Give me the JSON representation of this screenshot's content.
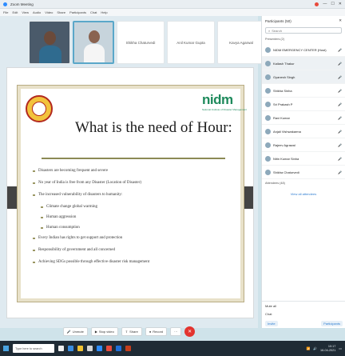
{
  "window": {
    "title": "Zoom Meeting",
    "menu": [
      "File",
      "Edit",
      "View",
      "Audio",
      "Video",
      "Share",
      "Participants",
      "Chat",
      "Help"
    ]
  },
  "colors": {
    "brand": "#1e8a5c",
    "end": "#e3342f",
    "accent": "#2f7dd1"
  },
  "videos": [
    {
      "label": ""
    },
    {
      "label": ""
    },
    {
      "label": "Shikha Chaturvedi"
    },
    {
      "label": "Anil Kumar Gupta"
    },
    {
      "label": "Kavya Agarwal"
    }
  ],
  "slide": {
    "title": "What is the need of Hour:",
    "logo": "nidm",
    "logo_sub": "National Institute of Disaster Management",
    "bullets": [
      {
        "text": "Disasters are becoming frequent and severe",
        "level": 1
      },
      {
        "text": "No year of India is free from any Disaster (Location of Disaster)",
        "level": 1
      },
      {
        "text": "The increased vulnerability of disasters to humanity:",
        "level": 1
      },
      {
        "text": "Climate change global warming",
        "level": 2
      },
      {
        "text": "Human aggression",
        "level": 2
      },
      {
        "text": "Human consumption",
        "level": 2
      },
      {
        "text": "Every Indian has rights to get support and protection",
        "level": 1
      },
      {
        "text": "Responsibility of government and all concerned",
        "level": 1
      },
      {
        "text": "Achieving SDGs possible through effective disaster risk management",
        "level": 1
      }
    ]
  },
  "controls": {
    "mic": "Unmute",
    "video": "Stop video",
    "share": "Share",
    "record": "Record",
    "end": "✕"
  },
  "panel": {
    "header": "Participants (50)",
    "search_placeholder": "Search",
    "section_host": "Presenters (2)",
    "section_attendees": "Attendees (48)",
    "participants": [
      {
        "name": "NIDM EMERGENCY CENTER (Host)",
        "initial": "N"
      },
      {
        "name": "Kailash Thakur",
        "initial": "K"
      },
      {
        "name": "Gyanesh Singh",
        "initial": "G"
      },
      {
        "name": "Shikha Sinha",
        "initial": "S"
      },
      {
        "name": "Sri Prakash P",
        "initial": "S"
      },
      {
        "name": "Ravi Kumar",
        "initial": "R"
      },
      {
        "name": "Anjali Vishwakarma",
        "initial": "A"
      },
      {
        "name": "Rajeev Agrawal",
        "initial": "R"
      },
      {
        "name": "Nitin Kumar Sinha",
        "initial": "N"
      },
      {
        "name": "Shikha Chaturvedi",
        "initial": "S"
      }
    ],
    "view_all": "View all attendees",
    "bottom_row": "Mute all",
    "chat_label": "Chat",
    "foot_left": "Invite",
    "foot_right": "Participants"
  },
  "taskbar": {
    "search": "Type here to search",
    "time": "10:17",
    "date": "16-04-2021"
  }
}
